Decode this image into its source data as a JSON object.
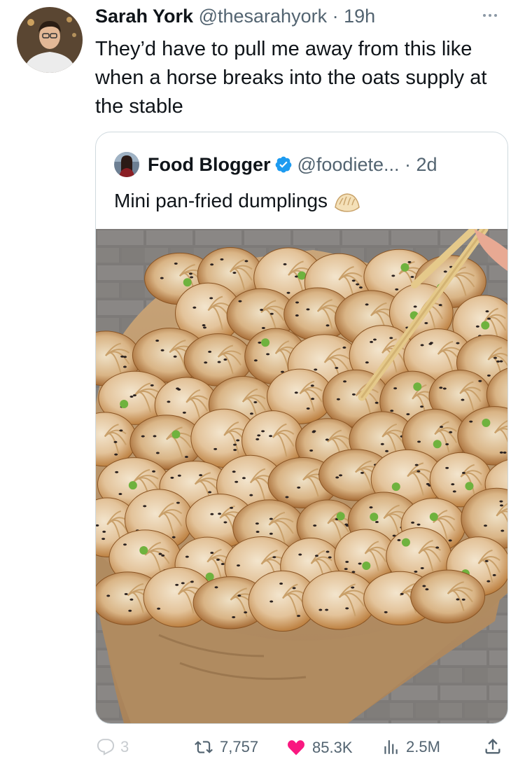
{
  "tweet": {
    "author_name": "Sarah York",
    "author_handle": "@thesarahyork",
    "separator": "·",
    "time": "19h",
    "text": "They’d have to pull me away from this like when a horse breaks into the oats supply at the stable"
  },
  "quoted_tweet": {
    "author_name": "Food Blogger",
    "author_handle": "@foodiete...",
    "separator": "·",
    "time": "2d",
    "text": "Mini pan-fried dumplings",
    "emoji": "dumpling",
    "media_alt": "Paper bag overflowing with pan-fried dumplings sprinkled with sesame seeds and scallions, chopsticks picking one up"
  },
  "actions": {
    "reply_count": "3",
    "retweet_count": "7,757",
    "like_count": "85.3K",
    "view_count": "2.5M"
  },
  "icons": {
    "more": "more-horizontal-icon",
    "verified": "verified-badge-icon",
    "reply": "reply-icon",
    "retweet": "retweet-icon",
    "like": "heart-icon",
    "views": "analytics-icon",
    "share": "share-icon"
  },
  "colors": {
    "like": "#f91880",
    "verified": "#1d9bf0",
    "muted_text": "#536471",
    "border": "#cfd9de"
  }
}
